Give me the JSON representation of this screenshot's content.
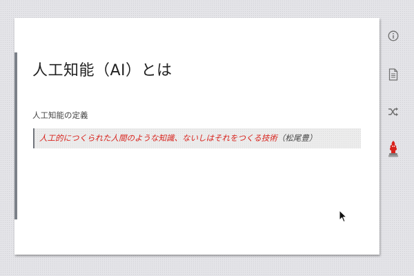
{
  "slide": {
    "title": "人工知能（AI）とは",
    "section_label": "人工知能の定義",
    "quote_text": "人工的につくられた人間のような知識、ないしはそれをつくる技術",
    "quote_source": "（松尾豊）"
  },
  "toolbar": {
    "items": [
      {
        "icon": "info-icon"
      },
      {
        "icon": "document-icon"
      },
      {
        "icon": "shuffle-icon"
      },
      {
        "icon": "mascot-icon"
      }
    ]
  },
  "colors": {
    "quote_highlight": "#d8231d",
    "accent_bar": "#7b8088",
    "toolbar_icon": "#6d6d6d",
    "mascot": "#d8231d"
  }
}
